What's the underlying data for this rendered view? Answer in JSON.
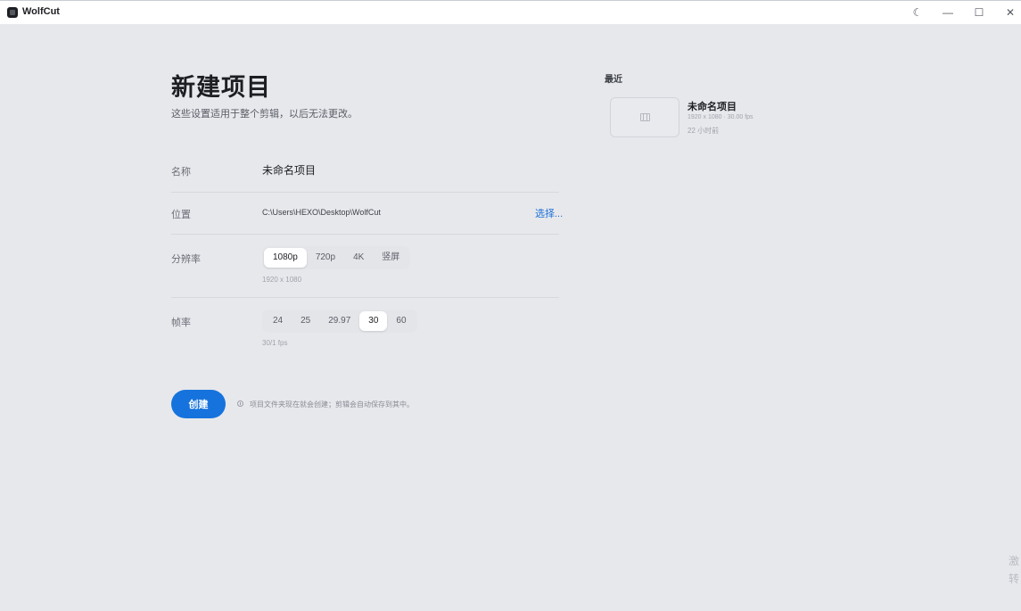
{
  "window": {
    "title": "WolfCut",
    "controls": {
      "theme": "☾",
      "minimize": "—",
      "maximize": "☐",
      "close": "✕"
    }
  },
  "header": {
    "title": "新建项目",
    "subtitle": "这些设置适用于整个剪辑，以后无法更改。"
  },
  "form": {
    "name": {
      "label": "名称",
      "value": "未命名项目"
    },
    "location": {
      "label": "位置",
      "value": "C:\\Users\\HEXO\\Desktop\\WolfCut",
      "choose_label": "选择..."
    },
    "resolution": {
      "label": "分辨率",
      "options": [
        "1080p",
        "720p",
        "4K",
        "竖屏"
      ],
      "selected": "1080p",
      "hint": "1920 x 1080"
    },
    "framerate": {
      "label": "帧率",
      "options": [
        "24",
        "25",
        "29.97",
        "30",
        "60"
      ],
      "selected": "30",
      "hint": "30/1 fps"
    }
  },
  "actions": {
    "create_label": "创建",
    "info_text": "项目文件夹现在就会创建；剪辑会自动保存到其中。"
  },
  "recent": {
    "title": "最近",
    "items": [
      {
        "name": "未命名项目",
        "meta": "1920 x 1080 · 30.00 fps",
        "time": "22 小时前"
      }
    ]
  },
  "edge": {
    "line1": "激",
    "line2": "转"
  },
  "colors": {
    "accent": "#1673dd",
    "link": "#1a6fd6",
    "background": "#e7e8ec"
  }
}
